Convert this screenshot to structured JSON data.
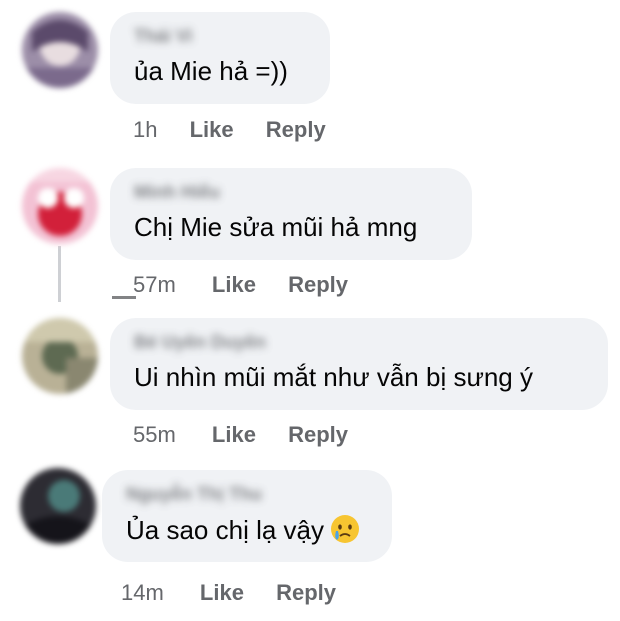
{
  "comments": [
    {
      "author": "Thái Vi",
      "text": "ủa Mie hả =))",
      "time": "1h",
      "like_label": "Like",
      "reply_label": "Reply"
    },
    {
      "author": "Minh Hiếu",
      "text": "Chị Mie sửa mũi hả mng",
      "time": "57m",
      "like_label": "Like",
      "reply_label": "Reply"
    },
    {
      "author": "Bé Uyên Duyên",
      "text": "Ui nhìn mũi mắt như vẫn bị sưng ý",
      "time": "55m",
      "like_label": "Like",
      "reply_label": "Reply"
    },
    {
      "author": "Nguyễn Thị Thu",
      "text": "Ủa sao chị lạ vậy",
      "emoji": "crying-face-emoji",
      "time": "14m",
      "like_label": "Like",
      "reply_label": "Reply"
    }
  ],
  "colors": {
    "bubble_bg": "#f0f2f5",
    "meta_text": "#65676b",
    "body_text": "#050505",
    "thread_line": "#ced0d4"
  }
}
